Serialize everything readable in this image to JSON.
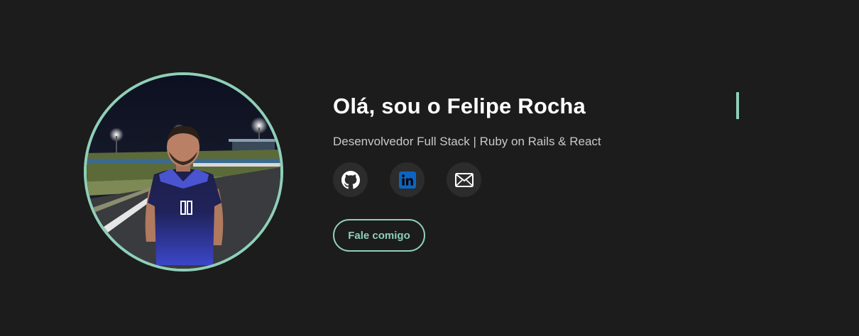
{
  "hero": {
    "title": "Olá, sou o Felipe Rocha",
    "subtitle": "Desenvolvedor Full Stack | Ruby on Rails & React",
    "cta_label": "Fale comigo",
    "socials": [
      {
        "name": "github",
        "icon": "github-icon"
      },
      {
        "name": "linkedin",
        "icon": "linkedin-icon"
      },
      {
        "name": "email",
        "icon": "mail-icon"
      }
    ]
  },
  "colors": {
    "background": "#1c1c1c",
    "accent": "#8fcfb8",
    "linkedin": "#0a66c2",
    "social_bg": "#2c2c2c"
  }
}
